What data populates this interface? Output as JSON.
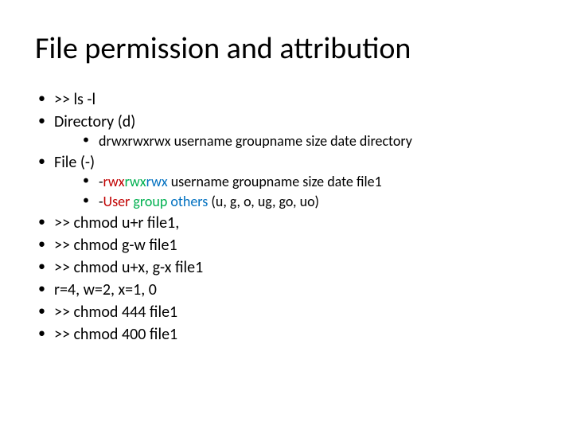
{
  "title": "File permission and attribution",
  "b1": ">> ls -l",
  "b2": "Directory (d)",
  "b2s1": "drwxrwxrwx username groupname size date directory",
  "b3": "File (-)",
  "b3s1_prefix": "-",
  "b3s1_rwx1": "rwx",
  "b3s1_rwx2": "rwx",
  "b3s1_rwx3": "rwx",
  "b3s1_rest": " username groupname size date file1",
  "b3s2_prefix": "-",
  "b3s2_user": "User",
  "b3s2_sep1": "  ",
  "b3s2_group": "group",
  "b3s2_sep2": "  ",
  "b3s2_others": "others",
  "b3s2_rest": " (u, g, o, ug, go, uo)",
  "b4": ">> chmod u+r file1,",
  "b5": ">> chmod g-w file1",
  "b6": ">> chmod u+x, g-x file1",
  "b7": "r=4, w=2, x=1, 0",
  "b8": ">> chmod 444 file1",
  "b9": ">> chmod 400 file1"
}
